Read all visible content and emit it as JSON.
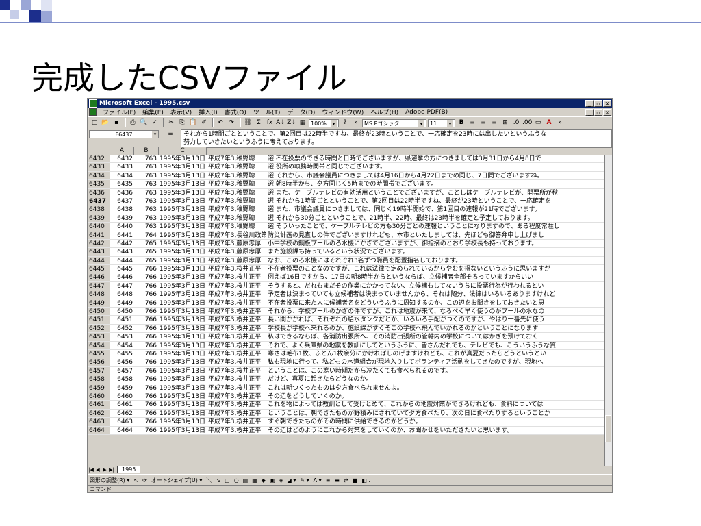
{
  "slide": {
    "title": "完成したCSVファイル"
  },
  "window": {
    "title": "Microsoft Excel - 1995.csv",
    "min": "_",
    "max": "▫",
    "close": "×"
  },
  "menu": [
    "ファイル(F)",
    "編集(E)",
    "表示(V)",
    "挿入(I)",
    "書式(O)",
    "ツール(T)",
    "データ(D)",
    "ウィンドウ(W)",
    "ヘルプ(H)",
    "Adobe PDF(B)"
  ],
  "toolbar": {
    "zoom": "100%",
    "font": "MS Pゴシック",
    "size": "11",
    "bold": "B"
  },
  "formula_bar": {
    "cell_ref": "F6437",
    "eq": "=",
    "content_line1": "それから1時間ごとということで、第2回目は22時半ですね、最終が23時ということで、一応確定を23時には出したいというふうな",
    "content_line2": "努力していきたいというふうに考えております。"
  },
  "columns": [
    "A",
    "B",
    "C"
  ],
  "rows": [
    {
      "n": "6432",
      "a": "6432",
      "b": "763",
      "c": "1995年3月13日",
      "d": "平成7年3,稚野聰",
      "e": "選 不在投票のできる時間と日時でございますが、県選挙の方につきましては3月31日から4月8日で"
    },
    {
      "n": "6433",
      "a": "6433",
      "b": "763",
      "c": "1995年3月13日",
      "d": "平成7年3,稚野聰",
      "e": "選 役所の執務時間帯と同じでございます。"
    },
    {
      "n": "6434",
      "a": "6434",
      "b": "763",
      "c": "1995年3月13日",
      "d": "平成7年3,稚野聰",
      "e": "選 それから、市議会議員につきましては4月16日から4月22日までの同じ、7日間でございますね。"
    },
    {
      "n": "6435",
      "a": "6435",
      "b": "763",
      "c": "1995年3月13日",
      "d": "平成7年3,稚野聰",
      "e": "選 朝8時半から、夕方同じく5時までの時間帯でございます。"
    },
    {
      "n": "6436",
      "a": "6436",
      "b": "763",
      "c": "1995年3月13日",
      "d": "平成7年3,稚野聰",
      "e": "選 また、ケーブルテレビの有効活用ということでございますが、ことしはケーブルテレビが、開票所が秋"
    },
    {
      "n": "6437",
      "a": "6437",
      "b": "763",
      "c": "1995年3月13日",
      "d": "平成7年3,稚野聰",
      "e": "選 それから1時間ごとということで、第2回目は22時半ですね、最終が23時ということで、一応確定を",
      "active": true
    },
    {
      "n": "6438",
      "a": "6438",
      "b": "763",
      "c": "1995年3月13日",
      "d": "平成7年3,稚野聰",
      "e": "選 また、市議会議員につきましては、同じく19時半開始で、第1回目の速報が21時でございます。"
    },
    {
      "n": "6439",
      "a": "6439",
      "b": "763",
      "c": "1995年3月13日",
      "d": "平成7年3,稚野聰",
      "e": "選 それから30分ごとということで、21時半、22時、最終は23時半を確定と予定しております。"
    },
    {
      "n": "6440",
      "a": "6440",
      "b": "763",
      "c": "1995年3月13日",
      "d": "平成7年3,稚野聰",
      "e": "選 そういったことで、ケーブルテレビの方も30分ごとの速報ということになりますので、ある程度常駐し"
    },
    {
      "n": "6441",
      "a": "6441",
      "b": "764",
      "c": "1995年3月13日",
      "d": "平成7年3,長谷川政策",
      "e": "防災計画の見直しの件でございますけれども、本市といたしましては、先ほども御答弁申し上げまし"
    },
    {
      "n": "6442",
      "a": "6442",
      "b": "765",
      "c": "1995年3月13日",
      "d": "平成7年3,藤原忠厚",
      "e": "小中学校の鋼板プールのろ水機にかぎでございますが、御指摘のとおり学校長も持っております。"
    },
    {
      "n": "6443",
      "a": "6443",
      "b": "765",
      "c": "1995年3月13日",
      "d": "平成7年3,藤原忠厚",
      "e": "また施設課も持っているという状況でございます。"
    },
    {
      "n": "6444",
      "a": "6444",
      "b": "765",
      "c": "1995年3月13日",
      "d": "平成7年3,藤原忠厚",
      "e": "なお、このろ水機にはそれぞれ3名ずつ職員を配置指名しております。"
    },
    {
      "n": "6445",
      "a": "6445",
      "b": "766",
      "c": "1995年3月13日",
      "d": "平成7年3,桜井正平",
      "e": "不在者投票のことなのですが、これは法律で定められているからやむを得ないというふうに思いますが"
    },
    {
      "n": "6446",
      "a": "6446",
      "b": "766",
      "c": "1995年3月13日",
      "d": "平成7年3,桜井正平",
      "e": "例えば16日ですから、17日の朝8時半からというならば、立候補者全部そろっていますからいい"
    },
    {
      "n": "6447",
      "a": "6447",
      "b": "766",
      "c": "1995年3月13日",
      "d": "平成7年3,桜井正平",
      "e": "そうすると、だれもまだその作業にかかってない、立候補もしてないうちに投票行為が行われるとい"
    },
    {
      "n": "6448",
      "a": "6448",
      "b": "766",
      "c": "1995年3月13日",
      "d": "平成7年3,桜井正平",
      "e": "予定者は決まっていても立候補者は決まっていませんから、それは随分、法律はいろいろありますけれど"
    },
    {
      "n": "6449",
      "a": "6449",
      "b": "766",
      "c": "1995年3月13日",
      "d": "平成7年3,桜井正平",
      "e": "不在者投票に来た人に候補者名をどういうふうに周知するのか、この辺をお聞きをしておきたいと思"
    },
    {
      "n": "6450",
      "a": "6450",
      "b": "766",
      "c": "1995年3月13日",
      "d": "平成7年3,桜井正平",
      "e": "それから、学校プールのかぎの件ですが、これは地震が来て、なるべく早く使うのがプールの水なの"
    },
    {
      "n": "6451",
      "a": "6451",
      "b": "766",
      "c": "1995年3月13日",
      "d": "平成7年3,桜井正平",
      "e": "長い間かかれば、それぞれの給水タンクだとか、いろいろ手配がつくのですが、やはり一番先に使う"
    },
    {
      "n": "6452",
      "a": "6452",
      "b": "766",
      "c": "1995年3月13日",
      "d": "平成7年3,桜井正平",
      "e": "学校長が学校へ来れるのか、施設課がすぐそこの学校へ飛んでいかれるのかということになります"
    },
    {
      "n": "6453",
      "a": "6453",
      "b": "766",
      "c": "1995年3月13日",
      "d": "平成7年3,桜井正平",
      "e": "私はできるならば、各消防出張所へ、その消防出張所の管轄内の学校についてはかぎを預けておく"
    },
    {
      "n": "6454",
      "a": "6454",
      "b": "766",
      "c": "1995年3月13日",
      "d": "平成7年3,桜井正平",
      "e": "それで、よく兵庫県の地震を教訓にしてというふうに、皆さんだれでも、テレビでも、こういうふうな質"
    },
    {
      "n": "6455",
      "a": "6455",
      "b": "766",
      "c": "1995年3月13日",
      "d": "平成7年3,桜井正平",
      "e": "寒さは毛布1枚、ふとん1枚余分にかければしのげますけれども、これが真夏だったらどうというとい"
    },
    {
      "n": "6456",
      "a": "6456",
      "b": "766",
      "c": "1995年3月13日",
      "d": "平成7年3,桜井正平",
      "e": "私も現地に行って、私どもの水道組合が現地入りしてボランティア活動をしてきたのですが、現地へ"
    },
    {
      "n": "6457",
      "a": "6457",
      "b": "766",
      "c": "1995年3月13日",
      "d": "平成7年3,桜井正平",
      "e": "ということは、この寒い時期だから冷たくても食べられるのです。"
    },
    {
      "n": "6458",
      "a": "6458",
      "b": "766",
      "c": "1995年3月13日",
      "d": "平成7年3,桜井正平",
      "e": "だけど、真夏に起きたらどうなのか。"
    },
    {
      "n": "6459",
      "a": "6459",
      "b": "766",
      "c": "1995年3月13日",
      "d": "平成7年3,桜井正平",
      "e": "これは朝つくったものは夕方食べられませんよ。"
    },
    {
      "n": "6460",
      "a": "6460",
      "b": "766",
      "c": "1995年3月13日",
      "d": "平成7年3,桜井正平",
      "e": "その辺をどうしていくのか。"
    },
    {
      "n": "6461",
      "a": "6461",
      "b": "766",
      "c": "1995年3月13日",
      "d": "平成7年3,桜井正平",
      "e": "これを物によっては教訓として受けとめて、これからの地震対策ができるけれども、食料については"
    },
    {
      "n": "6462",
      "a": "6462",
      "b": "766",
      "c": "1995年3月13日",
      "d": "平成7年3,桜井正平",
      "e": "ということは、朝できたものが野積みにされていて夕方食べたり、次の日に食べたりするということか"
    },
    {
      "n": "6463",
      "a": "6463",
      "b": "766",
      "c": "1995年3月13日",
      "d": "平成7年3,桜井正平",
      "e": "すぐ朝できたものがその時間に供給できるのかどうか。"
    },
    {
      "n": "6464",
      "a": "6464",
      "b": "766",
      "c": "1995年3月13日",
      "d": "平成7年3,桜井正平",
      "e": "その辺はどのようにこれから対策をしていくのか、お聞かせをいただきたいと思います。"
    }
  ],
  "sheet_tab": "1995",
  "drawbar": [
    "図形の調整(R) ▾",
    "↖",
    "⟳",
    "オートシェイプ(U) ▾",
    "＼",
    "↘",
    "□",
    "○",
    "▤",
    "▦",
    "◆",
    "▣",
    "◈",
    "◢ ▾",
    "✎ ▾",
    "A ▾",
    "≡",
    "▬",
    "⇄",
    "■",
    "◧ ."
  ],
  "status": "コマンド",
  "icons": {
    "new": "□",
    "open": "📂",
    "save": "▪",
    "print": "⎙",
    "preview": "🔍",
    "spell": "✓",
    "cut": "✂",
    "copy": "⎘",
    "paste": "📋",
    "format": "✐",
    "undo": "↶",
    "redo": "↷",
    "link": "⛓",
    "sum": "Σ",
    "fx": "fx",
    "sortasc": "A↓",
    "sortdesc": "Z↓",
    "chart": "▦",
    "help": "?",
    "more": "»",
    "align_l": "≡",
    "align_c": "≡",
    "align_r": "≡",
    "merge": "⊞",
    "decimal_inc": ".0",
    "decimal_dec": ".00",
    "border": "▭",
    "fontcolor": "A"
  }
}
